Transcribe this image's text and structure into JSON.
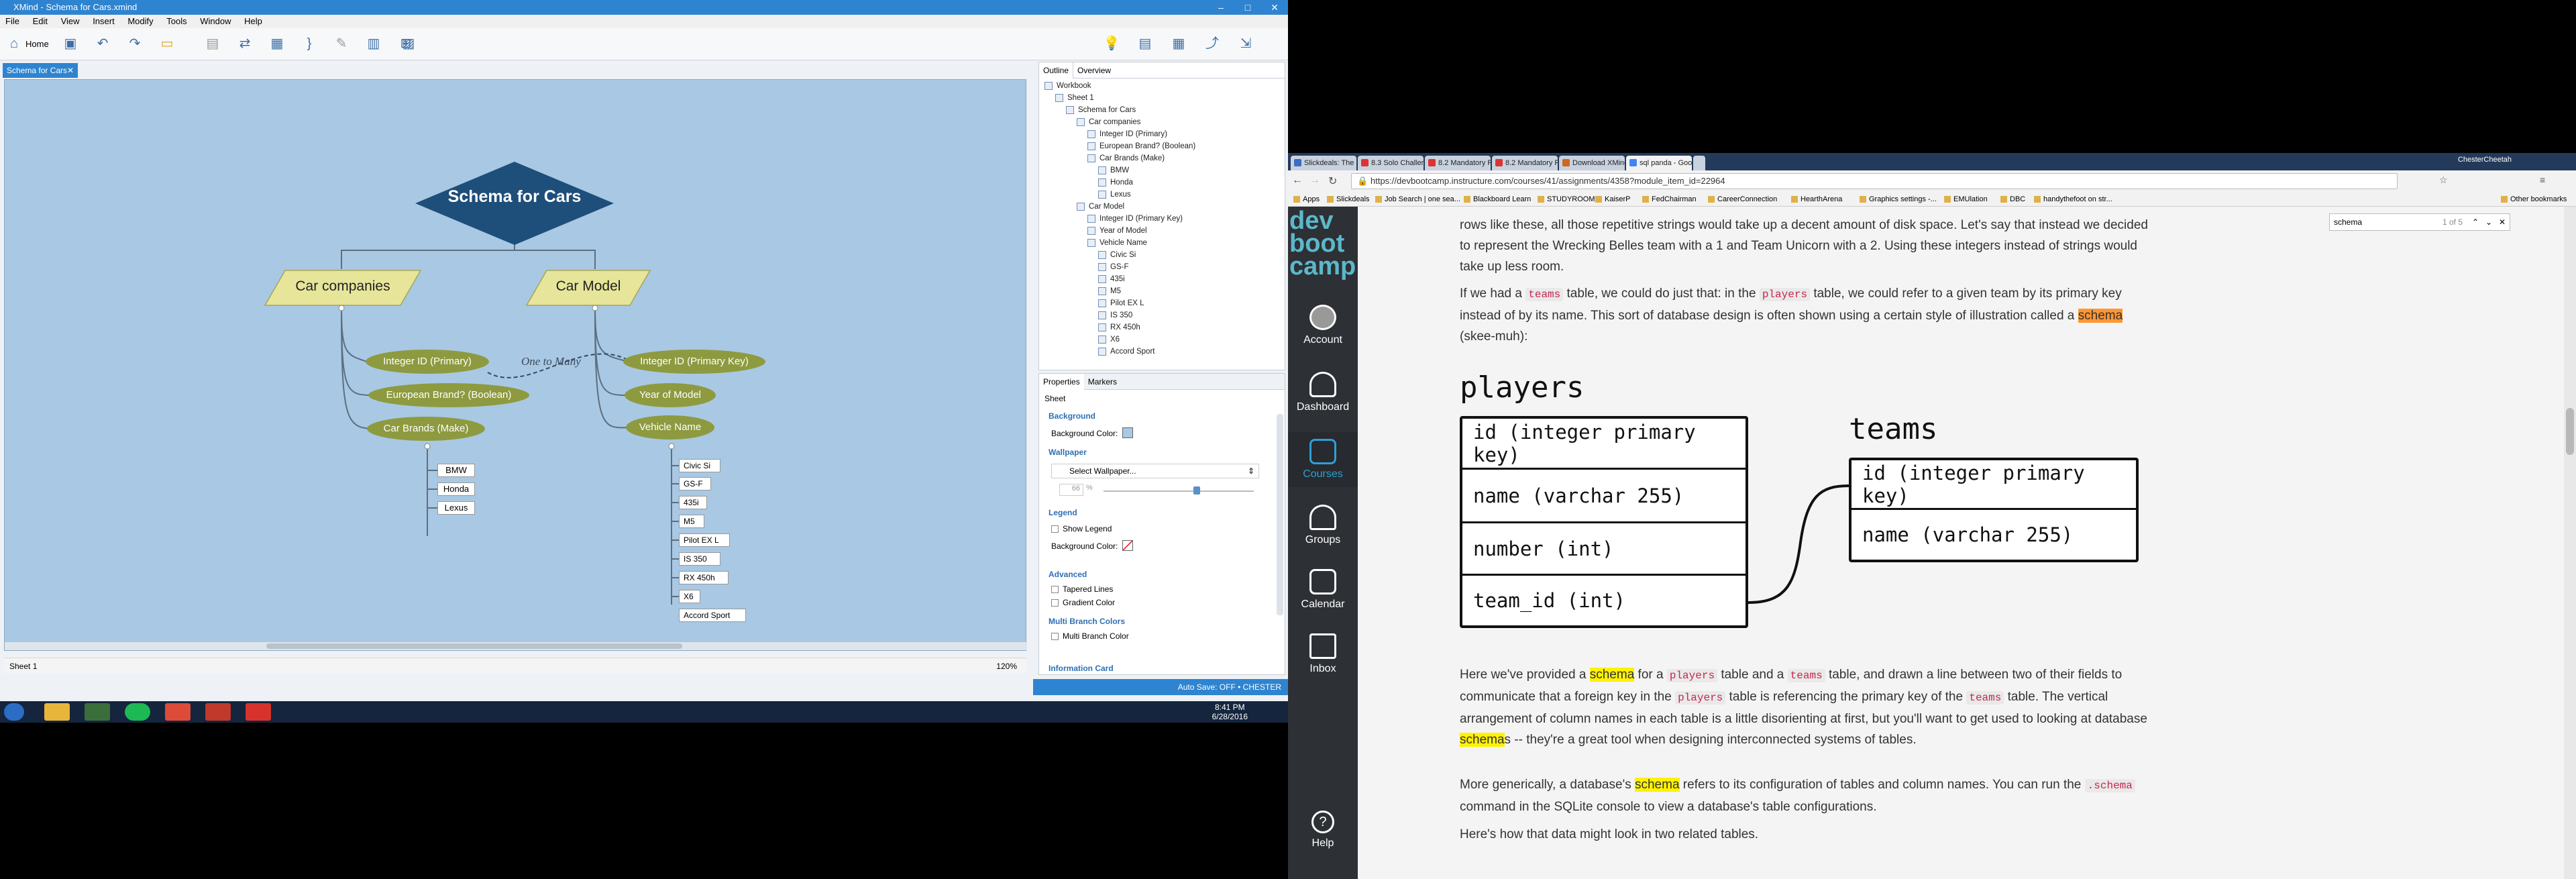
{
  "xmind": {
    "title": "XMind - Schema for Cars.xmind",
    "menu": [
      "File",
      "Edit",
      "View",
      "Insert",
      "Modify",
      "Tools",
      "Window",
      "Help"
    ],
    "home_label": "Home",
    "editor_tab": "Schema for Cars",
    "sheet_tab": "Sheet 1",
    "zoom": "120%",
    "status": "Auto Save: OFF  •  CHESTER",
    "map": {
      "central": "Schema for Cars",
      "left_main": "Car companies",
      "right_main": "Car Model",
      "relationship_label": "One to Many",
      "left_topics": [
        "Integer ID (Primary)",
        "European Brand? (Boolean)",
        "Car Brands (Make)"
      ],
      "right_topics": [
        "Integer ID (Primary Key)",
        "Year of Model",
        "Vehicle Name"
      ],
      "brands": [
        "BMW",
        "Honda",
        "Lexus"
      ],
      "vehicles": [
        "Civic Si",
        "GS-F",
        "435i",
        "M5",
        "Pilot EX L",
        "IS 350",
        "RX 450h",
        "X6",
        "Accord Sport"
      ]
    },
    "outline": {
      "tabs": [
        "Outline",
        "Overview"
      ],
      "rows": [
        "Workbook",
        "Sheet 1",
        "Schema for Cars",
        "Car companies",
        "Integer ID (Primary)",
        "European Brand? (Boolean)",
        "Car Brands (Make)",
        "BMW",
        "Honda",
        "Lexus",
        "Car Model",
        "Integer ID (Primary Key)",
        "Year of Model",
        "Vehicle Name",
        "Civic Si",
        "GS-F",
        "435i",
        "M5",
        "Pilot EX L",
        "IS 350",
        "RX 450h",
        "X6",
        "Accord Sport"
      ]
    },
    "properties": {
      "tabs": [
        "Properties",
        "Markers"
      ],
      "scope": "Sheet",
      "background_section": "Background",
      "background_color_label": "Background Color:",
      "wallpaper_section": "Wallpaper",
      "select_wallpaper": "Select Wallpaper...",
      "opacity": "66",
      "opacity_unit": "%",
      "legend_section": "Legend",
      "show_legend": "Show Legend",
      "legend_bg_label": "Background Color:",
      "advanced_section": "Advanced",
      "tapered_lines": "Tapered Lines",
      "gradient_color": "Gradient Color",
      "multi_branch_section": "Multi Branch Colors",
      "multi_branch_color": "Multi Branch Color",
      "info_card_section": "Information Card"
    },
    "colors": {
      "canvas": "#a9c8e3",
      "central": "#1e4e7a",
      "main_topic": "#e6e59a",
      "sub_topic": "#8e9a3f",
      "accent": "#2e84d0"
    }
  },
  "taskbar": {
    "time": "8:41 PM",
    "date": "6/28/2016"
  },
  "chrome": {
    "tabs": [
      "Slickdeals: The Best Deals...",
      "8.3 Solo Challenge: Build...",
      "8.2 Mandatory Pairing: Ch...",
      "8.2 Mandatory Pairing: Ch...",
      "Download XMind for Wi...",
      "sql panda - Google Sear..."
    ],
    "user": "ChesterCheetah",
    "url": "https://devbootcamp.instructure.com/courses/41/assignments/4358?module_item_id=22964",
    "bookmarks": [
      "Apps",
      "Slickdeals",
      "Job Search | one sea...",
      "Blackboard Learn",
      "STUDYROOM",
      "KaiserP",
      "FedChairman",
      "CareerConnection",
      "HearthArena",
      "Graphics settings -...",
      "EMUlation",
      "DBC",
      "handythefoot on str...",
      "Other bookmarks"
    ],
    "find": {
      "query": "schema",
      "count": "1 of 5"
    },
    "sidebar": {
      "logo": [
        "dev",
        "boot",
        "camp"
      ],
      "items": [
        "Account",
        "Dashboard",
        "Courses",
        "Groups",
        "Calendar",
        "Inbox",
        "Help"
      ]
    },
    "article": {
      "p1": "rows like these, all those repetitive strings would take up a decent amount of disk space. Let's say that instead we decided to represent the Wrecking Belles team with a 1 and Team Unicorn with a 2. Using these integers instead of strings would take up less room.",
      "p2_a": "If we had a ",
      "p2_code1": "teams",
      "p2_b": " table, we could do just that: in the ",
      "p2_code2": "players",
      "p2_c": " table, we could refer to a given team by its primary key instead of by its name. This sort of database design is often shown using a certain style of illustration called a ",
      "p2_mark": "schema",
      "p2_d": " (skee-muh):",
      "players_title": "players",
      "players_rows": [
        "id (integer primary key)",
        "name (varchar 255)",
        "number (int)",
        "team_id (int)"
      ],
      "teams_title": "teams",
      "teams_rows": [
        "id (integer primary key)",
        "name (varchar 255)"
      ],
      "p3_a": "Here we've provided a ",
      "p3_mark": "schema",
      "p3_b": " for a ",
      "p3_code1": "players",
      "p3_c": " table and a ",
      "p3_code2": "teams",
      "p3_d": " table, and drawn a line between two of their fields to communicate that a foreign key in the ",
      "p3_code3": "players",
      "p3_e": " table is referencing the primary key of the ",
      "p3_code4": "teams",
      "p3_f": " table. The vertical arrangement of column names in each table is a little disorienting at first, but you'll want to get used to looking at database ",
      "p3_mark2": "schema",
      "p3_g": "s -- they're a great tool when designing interconnected systems of tables.",
      "p4_a": "More generically, a database's ",
      "p4_mark": "schema",
      "p4_b": " refers to its configuration of tables and column names. You can run the ",
      "p4_code": ".schema",
      "p4_c": " command in the SQLite console to view a database's table configurations.",
      "p5": "Here's how that data might look in two related tables."
    }
  }
}
